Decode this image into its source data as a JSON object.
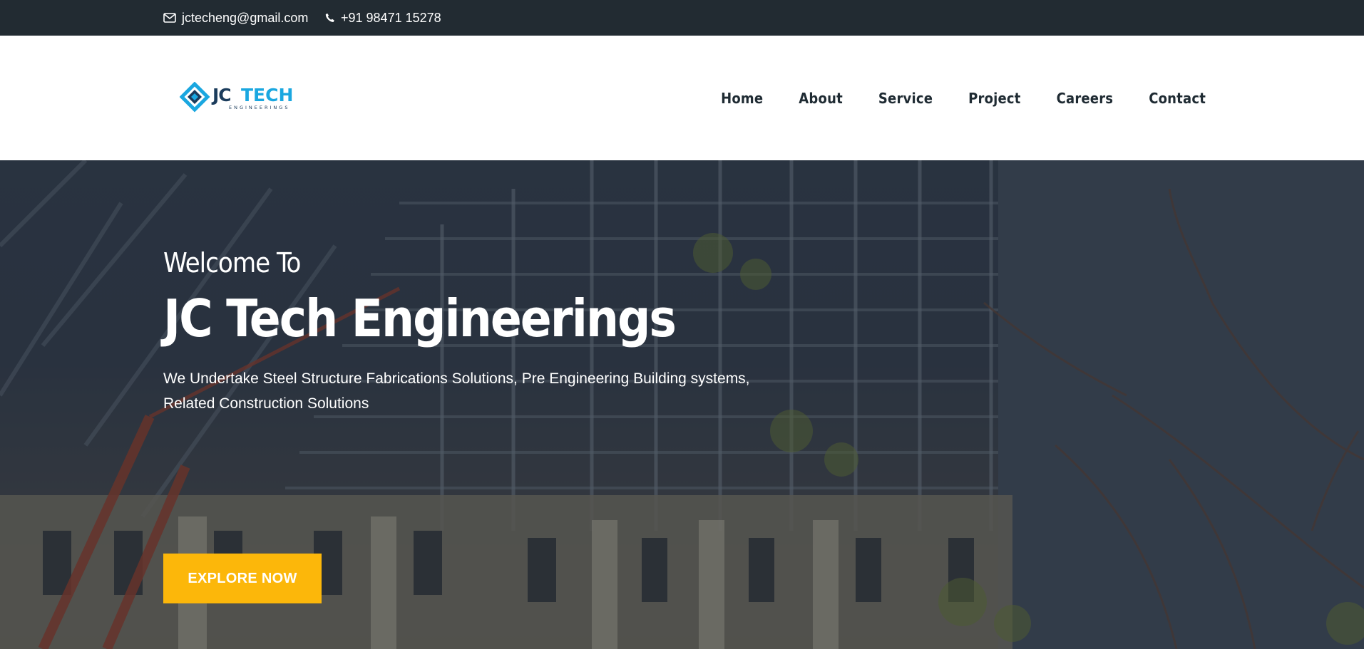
{
  "topbar": {
    "email": "jctecheng@gmail.com",
    "phone": "+91 98471 15278",
    "email_icon": "envelope-icon",
    "phone_icon": "phone-icon"
  },
  "header": {
    "logo": {
      "text_main": "JC TECH",
      "text_sub": "ENGINEERINGS"
    },
    "nav": [
      {
        "label": "Home"
      },
      {
        "label": "About"
      },
      {
        "label": "Service"
      },
      {
        "label": "Project"
      },
      {
        "label": "Careers"
      },
      {
        "label": "Contact"
      }
    ]
  },
  "hero": {
    "welcome": "Welcome To",
    "title": "JC Tech Engineerings",
    "tagline_line1": "We Undertake Steel Structure Fabrications Solutions, Pre Engineering Building systems,",
    "tagline_line2": "Related Construction Solutions",
    "cta_label": "EXPLORE NOW"
  },
  "colors": {
    "topbar_bg": "#222b32",
    "nav_text": "#1f2b33",
    "cta_bg": "#fcb70a",
    "logo_dark": "#1b3c5c",
    "logo_accent": "#1aa7e0"
  }
}
